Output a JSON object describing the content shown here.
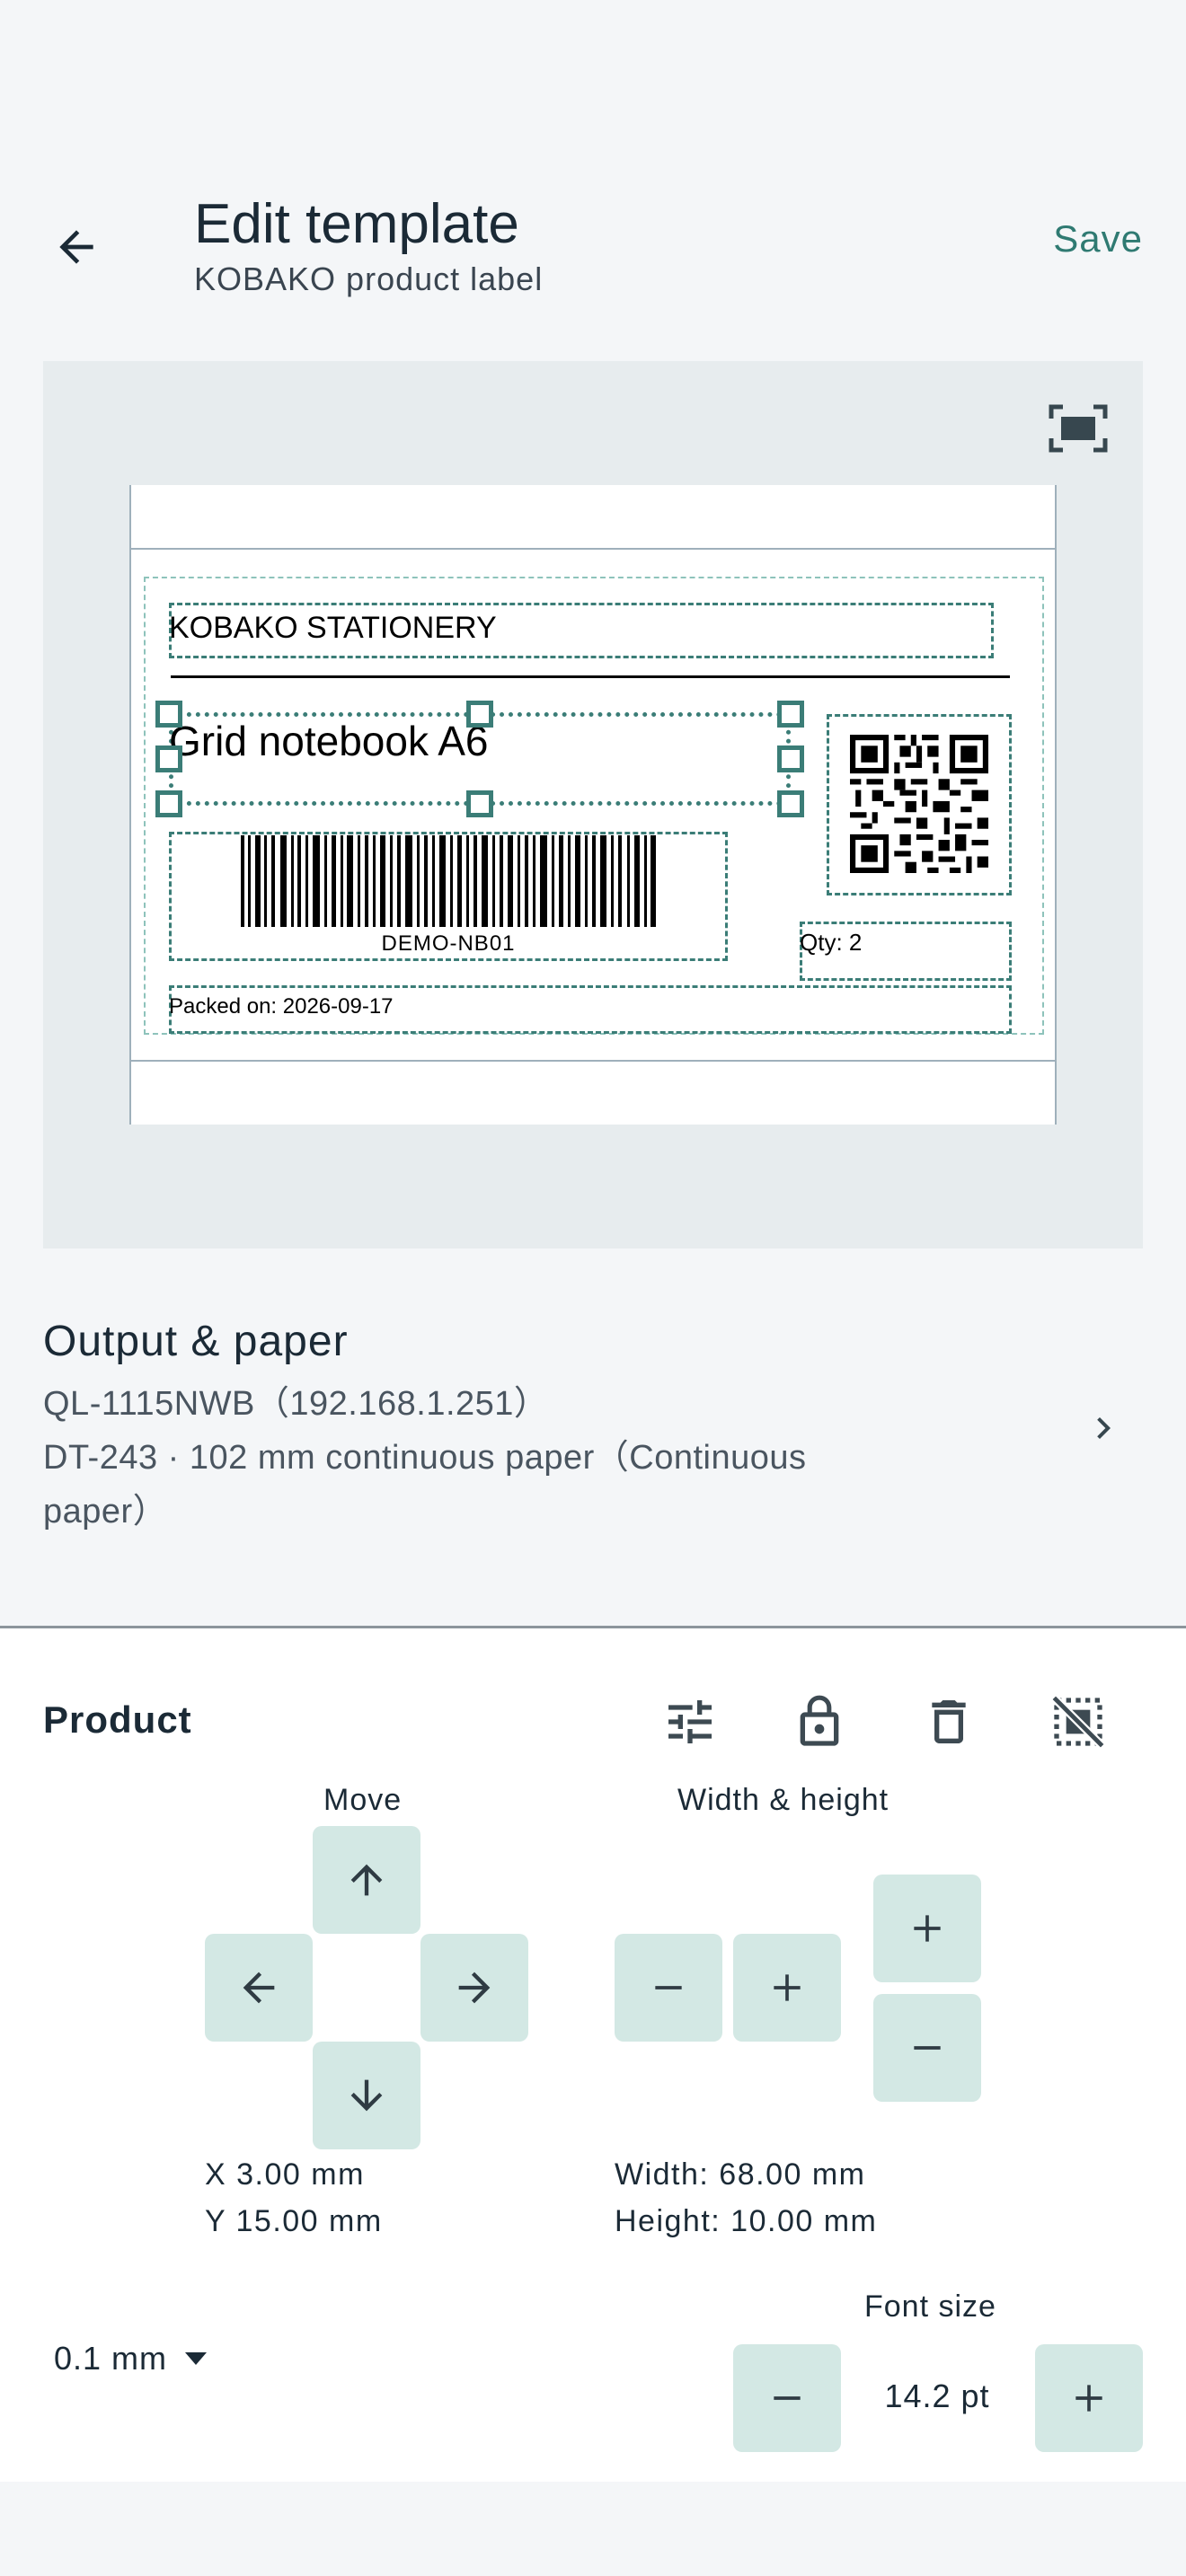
{
  "header": {
    "title": "Edit template",
    "subtitle": "KOBAKO product label",
    "save_label": "Save"
  },
  "label": {
    "brand": "KOBAKO STATIONERY",
    "product_name": "Grid notebook A6",
    "barcode_value": "DEMO-NB01",
    "qty": "Qty: 2",
    "packed_on": "Packed on: 2026-09-17"
  },
  "output": {
    "title": "Output & paper",
    "printer": "QL-1115NWB（192.168.1.251）",
    "paper_line1": "DT-243 · 102 mm continuous paper（Continuous",
    "paper_line2": "paper）"
  },
  "panel": {
    "title": "Product",
    "move_label": "Move",
    "size_label": "Width & height",
    "x_value": "X 3.00 mm",
    "y_value": "Y 15.00 mm",
    "width_value": "Width: 68.00 mm",
    "height_value": "Height: 10.00 mm",
    "step_value": "0.1 mm",
    "font_size_label": "Font size",
    "font_size_value": "14.2 pt"
  },
  "colors": {
    "accent": "#2f7a72",
    "button_bg": "#d3e8e4",
    "selection": "#3b7d77",
    "canvas_bg": "#e7ecee"
  },
  "icons": [
    "arrow-back-icon",
    "fit-screen-icon",
    "chevron-right-icon",
    "tune-icon",
    "lock-open-icon",
    "delete-icon",
    "deselect-icon",
    "arrow-up-icon",
    "arrow-left-icon",
    "arrow-right-icon",
    "arrow-down-icon",
    "minus-icon",
    "plus-icon",
    "dropdown-arrow-icon"
  ]
}
